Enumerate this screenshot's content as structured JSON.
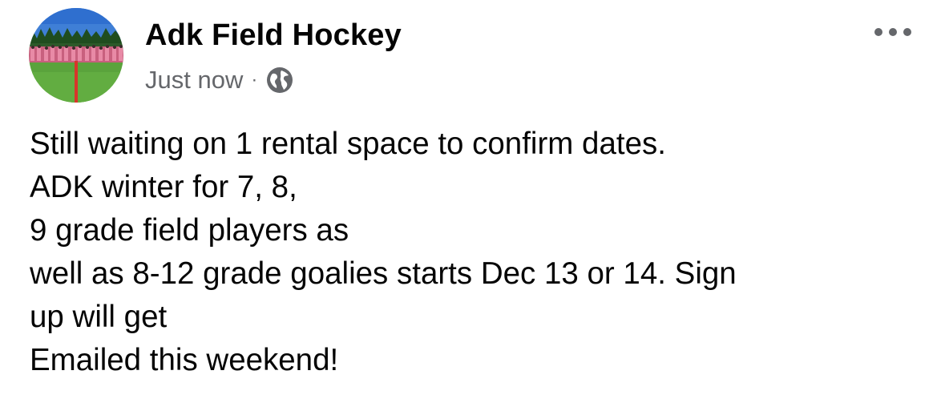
{
  "post": {
    "author": "Adk Field Hockey",
    "timestamp": "Just now",
    "separator": "·",
    "audience_icon": "globe-icon",
    "more_icon": "more-horizontal-icon",
    "body_lines": [
      "Still waiting on 1 rental space to confirm dates.",
      "ADK winter for 7, 8,",
      "9 grade field players as",
      "well as 8-12 grade goalies starts Dec 13 or 14. Sign",
      "up will get",
      "Emailed this weekend!"
    ]
  },
  "colors": {
    "text_primary": "#050505",
    "text_secondary": "#65676b",
    "background": "#ffffff"
  }
}
